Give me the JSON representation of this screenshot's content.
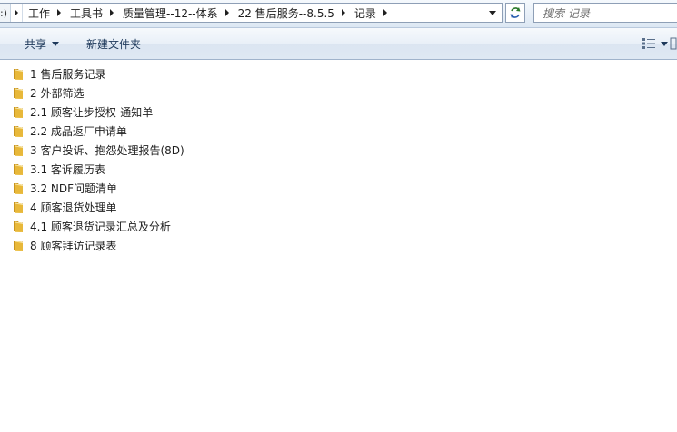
{
  "address_bar": {
    "drive_stub": ":)",
    "breadcrumbs": [
      {
        "label": "工作"
      },
      {
        "label": "工具书"
      },
      {
        "label": "质量管理--12--体系"
      },
      {
        "label": "22 售后服务--8.5.5"
      },
      {
        "label": "记录"
      }
    ]
  },
  "search": {
    "placeholder": "搜索 记录"
  },
  "toolbar": {
    "share_label": "共享",
    "new_folder_label": "新建文件夹"
  },
  "files": [
    {
      "name": "1 售后服务记录"
    },
    {
      "name": "2 外部筛选"
    },
    {
      "name": "2.1 顾客让步授权-通知单"
    },
    {
      "name": "2.2 成品返厂申请单"
    },
    {
      "name": "3 客户投诉、抱怨处理报告(8D)"
    },
    {
      "name": "3.1 客诉履历表"
    },
    {
      "name": "3.2 NDF问题清单"
    },
    {
      "name": "4 顾客退货处理单"
    },
    {
      "name": "4.1 顾客退货记录汇总及分析"
    },
    {
      "name": "8 顾客拜访记录表"
    }
  ],
  "colors": {
    "folder": "#e8b83a",
    "toolbar_text": "#1e395b"
  }
}
